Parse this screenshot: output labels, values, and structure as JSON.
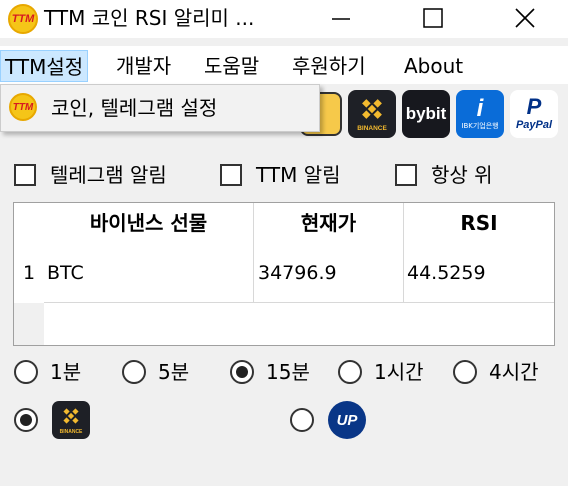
{
  "window": {
    "title": "TTM 코인 RSI 알리미 ...",
    "minimize_glyph": "—",
    "maximize_glyph": "☐",
    "close_glyph": "✕"
  },
  "logo_text": "TTM",
  "menu": {
    "items": [
      "TTM설정",
      "개발자",
      "도움말",
      "후원하기",
      "About"
    ]
  },
  "dropdown": {
    "items": [
      {
        "label": "코인, 텔레그램 설정",
        "icon": "ttm-logo-icon"
      }
    ]
  },
  "toolbar": {
    "icons": [
      {
        "name": "binance-icon",
        "label": "BINANCE",
        "bg": "#1e2026",
        "accent": "#f3ba2f"
      },
      {
        "name": "bybit-icon",
        "label": "bybit",
        "bg": "#17181e",
        "accent": "#f7a600"
      },
      {
        "name": "ibk-icon",
        "label": "IBK기업은행",
        "bg": "#0a6cd8",
        "accent": "#ffffff"
      },
      {
        "name": "paypal-icon",
        "label": "PayPal",
        "bg": "#ffffff",
        "accent": "#003087"
      }
    ]
  },
  "options": {
    "telegram_alert": {
      "label": "텔레그램 알림",
      "checked": false
    },
    "ttm_alert": {
      "label": "TTM 알림",
      "checked": false
    },
    "always_on_top": {
      "label": "항상 위",
      "checked": false
    }
  },
  "table": {
    "columns": [
      "바이낸스 선물",
      "현재가",
      "RSI"
    ],
    "rows": [
      {
        "index": "1",
        "symbol": "BTC",
        "price": "34796.9",
        "rsi": "44.5259"
      }
    ]
  },
  "timeframes": {
    "options": [
      "1분",
      "5분",
      "15분",
      "1시간",
      "4시간"
    ],
    "selected": "15분"
  },
  "exchanges": {
    "options": [
      {
        "name": "binance",
        "label": "BINANCE",
        "selected": true
      },
      {
        "name": "upbit",
        "label": "UP",
        "selected": false
      }
    ]
  },
  "colors": {
    "menu_highlight": "#cce8ff",
    "binance_yellow": "#f3ba2f",
    "upbit_blue": "#093687"
  }
}
